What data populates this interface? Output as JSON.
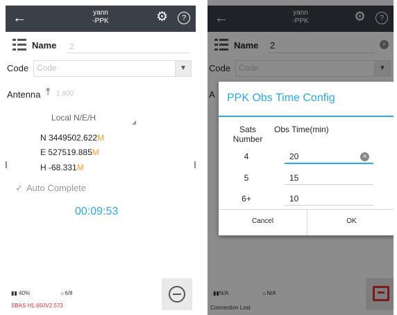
{
  "left_screen": {
    "topbar": {
      "back_icon": "arrow-left-icon",
      "title_line1": "yann",
      "title_line2": "-PPK",
      "settings_icon": "gear-icon",
      "help_label": "?"
    },
    "name": {
      "label": "Name",
      "value": "2"
    },
    "code": {
      "label": "Code",
      "placeholder": "Code"
    },
    "antenna": {
      "label": "Antenna",
      "value": "1.800"
    },
    "coord_system": "Local N/E/H",
    "coords": {
      "n": {
        "prefix": "N ",
        "value": "3449502.622",
        "unit": "M"
      },
      "e": {
        "prefix": "E ",
        "value": "527519.885",
        "unit": "M"
      },
      "h": {
        "prefix": "H ",
        "value": "-68.331",
        "unit": "M"
      }
    },
    "auto_complete": {
      "check": "✓",
      "label": "Auto Complete"
    },
    "timer": "00:09:53",
    "status": {
      "battery": "40%",
      "sats": "6/8",
      "sbas": "SBAS H1.650V2.573"
    }
  },
  "right_screen": {
    "topbar": {
      "back_icon": "arrow-left-icon",
      "title_line1": "yann",
      "title_line2": "-PPK",
      "settings_icon": "gear-icon",
      "help_label": "?"
    },
    "name": {
      "label": "Name",
      "value": "2"
    },
    "code": {
      "label": "Code",
      "placeholder": "Code"
    },
    "antenna_label": "A",
    "dialog": {
      "title": "PPK Obs Time Config",
      "col_sats_line1": "Sats",
      "col_sats_line2": "Number",
      "col_time": "Obs Time(min)",
      "rows": [
        {
          "sats": "4",
          "time": "20"
        },
        {
          "sats": "5",
          "time": "15"
        },
        {
          "sats": "6+",
          "time": "10"
        }
      ],
      "cancel": "Cancel",
      "ok": "OK"
    },
    "status": {
      "battery": "N/A",
      "sats": "N/A",
      "connection": "Connection Lost"
    }
  },
  "colors": {
    "accent": "#2aa8e8",
    "warning": "#ff9d2b",
    "error": "#e03030",
    "topbar": "#3a3f48"
  }
}
